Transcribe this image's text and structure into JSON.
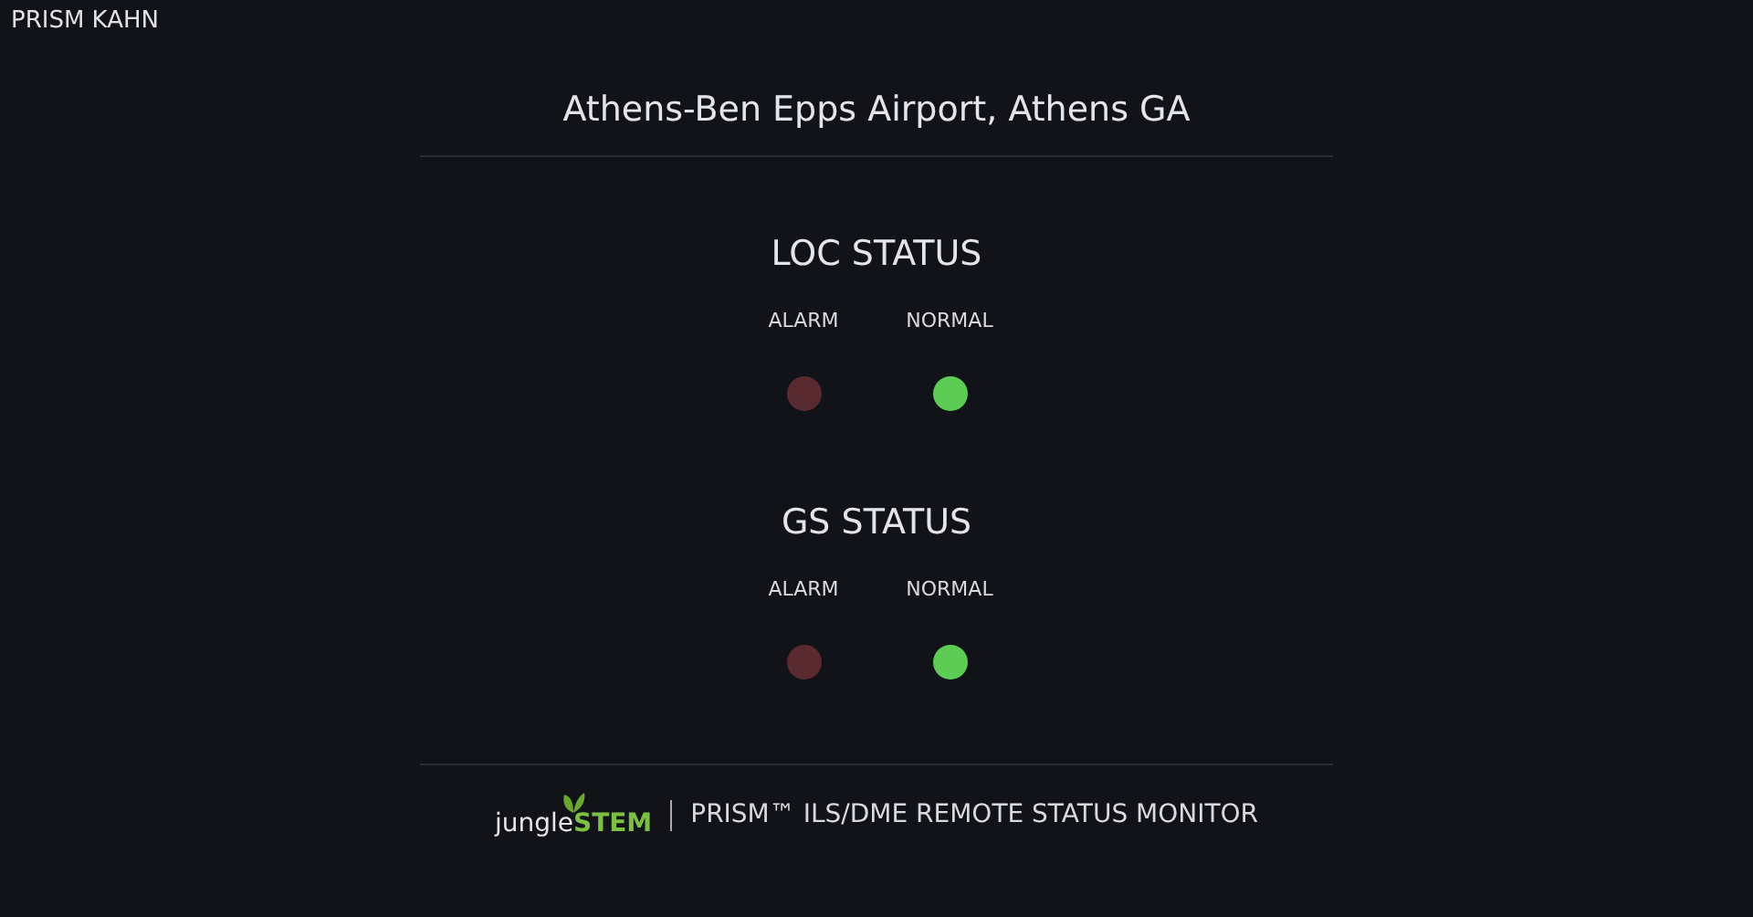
{
  "app_name": "PRISM KAHN",
  "title": "Athens-Ben Epps Airport, Athens GA",
  "sections": [
    {
      "heading": "LOC STATUS",
      "indicators": [
        {
          "label": "ALARM",
          "kind": "alarm",
          "on": false
        },
        {
          "label": "NORMAL",
          "kind": "normal",
          "on": true
        }
      ]
    },
    {
      "heading": "GS STATUS",
      "indicators": [
        {
          "label": "ALARM",
          "kind": "alarm",
          "on": false
        },
        {
          "label": "NORMAL",
          "kind": "normal",
          "on": true
        }
      ]
    }
  ],
  "footer": {
    "logo": {
      "first": "jungle",
      "second": "STEM"
    },
    "caption": "PRISM™ ILS/DME REMOTE STATUS MONITOR"
  }
}
